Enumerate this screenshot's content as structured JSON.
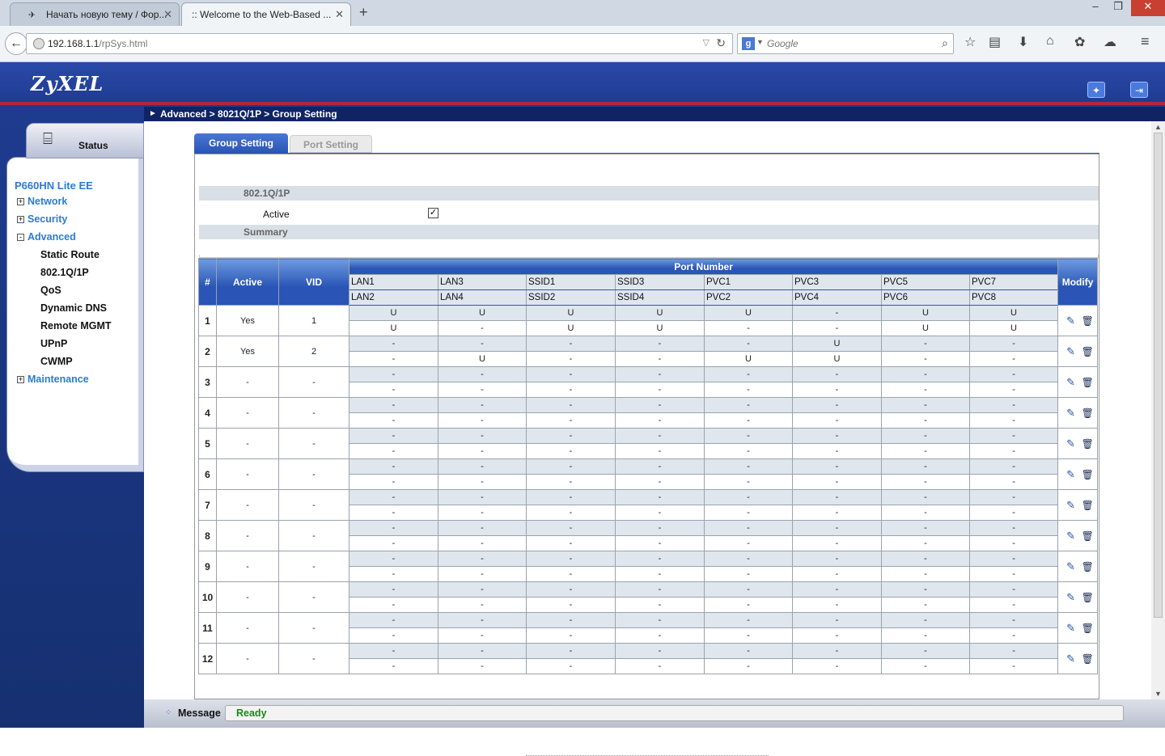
{
  "browser": {
    "tabs": [
      {
        "title": "Начать новую тему / Фор..."
      },
      {
        "title": ":: Welcome to the Web-Based ..."
      }
    ],
    "url_host": "192.168.1.1",
    "url_path": "/rpSys.html",
    "search_placeholder": "Google"
  },
  "router": {
    "logo": "ZyXEL",
    "breadcrumb": "Advanced > 8021Q/1P > Group Setting",
    "status_label": "Status",
    "model": "P660HN Lite EE",
    "menu": [
      {
        "label": "Network",
        "level": "top",
        "expander": "+"
      },
      {
        "label": "Security",
        "level": "top",
        "expander": "+"
      },
      {
        "label": "Advanced",
        "level": "top",
        "expander": "-"
      },
      {
        "label": "Static Route",
        "level": "sub"
      },
      {
        "label": "802.1Q/1P",
        "level": "sub"
      },
      {
        "label": "QoS",
        "level": "sub"
      },
      {
        "label": "Dynamic DNS",
        "level": "sub"
      },
      {
        "label": "Remote MGMT",
        "level": "sub"
      },
      {
        "label": "UPnP",
        "level": "sub"
      },
      {
        "label": "CWMP",
        "level": "sub"
      },
      {
        "label": "Maintenance",
        "level": "top",
        "expander": "+"
      }
    ]
  },
  "content": {
    "tabs": {
      "active": "Group Setting",
      "inactive": "Port Setting"
    },
    "section1_title": "802.1Q/1P",
    "active_label": "Active",
    "active_checked": "✓",
    "summary_title": "Summary",
    "table": {
      "headers": {
        "num": "#",
        "active": "Active",
        "vid": "VID",
        "port_number": "Port Number",
        "modify": "Modify"
      },
      "port_labels_top": [
        "LAN1",
        "LAN3",
        "SSID1",
        "SSID3",
        "PVC1",
        "PVC3",
        "PVC5",
        "PVC7"
      ],
      "port_labels_bottom": [
        "LAN2",
        "LAN4",
        "SSID2",
        "SSID4",
        "PVC2",
        "PVC4",
        "PVC6",
        "PVC8"
      ],
      "rows": [
        {
          "num": "1",
          "active": "Yes",
          "vid": "1",
          "top": [
            "U",
            "U",
            "U",
            "U",
            "U",
            "-",
            "U",
            "U"
          ],
          "bottom": [
            "U",
            "-",
            "U",
            "U",
            "-",
            "-",
            "U",
            "U"
          ]
        },
        {
          "num": "2",
          "active": "Yes",
          "vid": "2",
          "top": [
            "-",
            "-",
            "-",
            "-",
            "-",
            "U",
            "-",
            "-"
          ],
          "bottom": [
            "-",
            "U",
            "-",
            "-",
            "U",
            "U",
            "-",
            "-"
          ]
        },
        {
          "num": "3",
          "active": "-",
          "vid": "-",
          "top": [
            "-",
            "-",
            "-",
            "-",
            "-",
            "-",
            "-",
            "-"
          ],
          "bottom": [
            "-",
            "-",
            "-",
            "-",
            "-",
            "-",
            "-",
            "-"
          ]
        },
        {
          "num": "4",
          "active": "-",
          "vid": "-",
          "top": [
            "-",
            "-",
            "-",
            "-",
            "-",
            "-",
            "-",
            "-"
          ],
          "bottom": [
            "-",
            "-",
            "-",
            "-",
            "-",
            "-",
            "-",
            "-"
          ]
        },
        {
          "num": "5",
          "active": "-",
          "vid": "-",
          "top": [
            "-",
            "-",
            "-",
            "-",
            "-",
            "-",
            "-",
            "-"
          ],
          "bottom": [
            "-",
            "-",
            "-",
            "-",
            "-",
            "-",
            "-",
            "-"
          ]
        },
        {
          "num": "6",
          "active": "-",
          "vid": "-",
          "top": [
            "-",
            "-",
            "-",
            "-",
            "-",
            "-",
            "-",
            "-"
          ],
          "bottom": [
            "-",
            "-",
            "-",
            "-",
            "-",
            "-",
            "-",
            "-"
          ]
        },
        {
          "num": "7",
          "active": "-",
          "vid": "-",
          "top": [
            "-",
            "-",
            "-",
            "-",
            "-",
            "-",
            "-",
            "-"
          ],
          "bottom": [
            "-",
            "-",
            "-",
            "-",
            "-",
            "-",
            "-",
            "-"
          ]
        },
        {
          "num": "8",
          "active": "-",
          "vid": "-",
          "top": [
            "-",
            "-",
            "-",
            "-",
            "-",
            "-",
            "-",
            "-"
          ],
          "bottom": [
            "-",
            "-",
            "-",
            "-",
            "-",
            "-",
            "-",
            "-"
          ]
        },
        {
          "num": "9",
          "active": "-",
          "vid": "-",
          "top": [
            "-",
            "-",
            "-",
            "-",
            "-",
            "-",
            "-",
            "-"
          ],
          "bottom": [
            "-",
            "-",
            "-",
            "-",
            "-",
            "-",
            "-",
            "-"
          ]
        },
        {
          "num": "10",
          "active": "-",
          "vid": "-",
          "top": [
            "-",
            "-",
            "-",
            "-",
            "-",
            "-",
            "-",
            "-"
          ],
          "bottom": [
            "-",
            "-",
            "-",
            "-",
            "-",
            "-",
            "-",
            "-"
          ]
        },
        {
          "num": "11",
          "active": "-",
          "vid": "-",
          "top": [
            "-",
            "-",
            "-",
            "-",
            "-",
            "-",
            "-",
            "-"
          ],
          "bottom": [
            "-",
            "-",
            "-",
            "-",
            "-",
            "-",
            "-",
            "-"
          ]
        },
        {
          "num": "12",
          "active": "-",
          "vid": "-",
          "top": [
            "-",
            "-",
            "-",
            "-",
            "-",
            "-",
            "-",
            "-"
          ],
          "bottom": [
            "-",
            "-",
            "-",
            "-",
            "-",
            "-",
            "-",
            "-"
          ]
        }
      ]
    }
  },
  "message": {
    "label": "Message",
    "value": "Ready"
  },
  "colors": {
    "accent": "#2a55b6",
    "banner": "#1e3a90",
    "brand_red": "#b3263b",
    "status_ok": "#1a8a1a"
  }
}
